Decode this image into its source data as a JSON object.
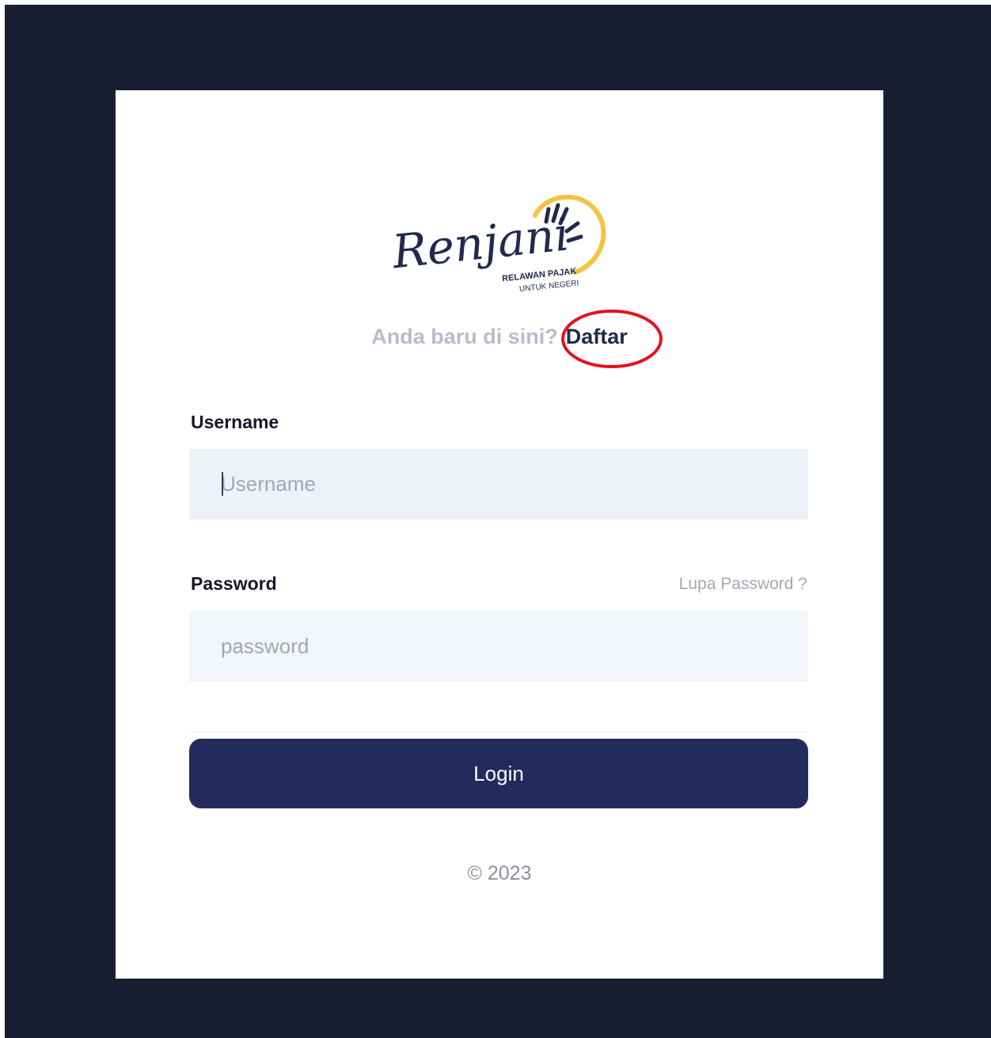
{
  "logo": {
    "wordmark": "Renjani",
    "tagline_line1": "RELAWAN PAJAK",
    "tagline_line2": "UNTUK NEGERI",
    "colors": {
      "navy": "#22294e",
      "yellow": "#f5c242"
    }
  },
  "signup": {
    "prompt": "Anda baru di sini?",
    "link_label": "Daftar"
  },
  "annotation": {
    "color": "#e4141d",
    "shape": "circle",
    "target": "Daftar"
  },
  "form": {
    "username": {
      "label": "Username",
      "placeholder": "Username",
      "value": ""
    },
    "password": {
      "label": "Password",
      "placeholder": "password",
      "value": "",
      "forgot_label": "Lupa Password ?"
    },
    "submit_label": "Login"
  },
  "footer": {
    "copyright": "© 2023"
  },
  "colors": {
    "background": "#1a1e33",
    "card": "#ffffff",
    "button": "#222b5c",
    "input_bg": "#edf2f7"
  }
}
